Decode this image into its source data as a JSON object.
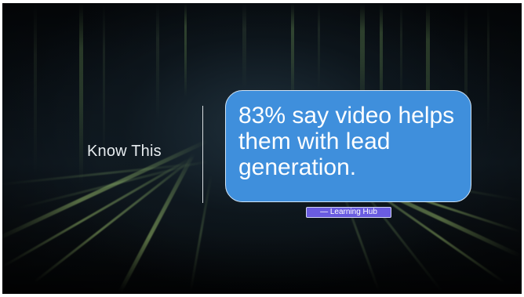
{
  "slide": {
    "heading": "Know This",
    "callout_text": "83% say video helps them with lead generation.",
    "attribution": "— Learning Hub"
  },
  "colors": {
    "background": "#0b1218",
    "callout_fill": "#3f8fdc",
    "callout_border": "#cfe3f6",
    "attribution_fill": "#6a5ce0",
    "divider": "#d8dde0",
    "heading_text": "#e6ebee",
    "light_streaks": "#aad278"
  }
}
